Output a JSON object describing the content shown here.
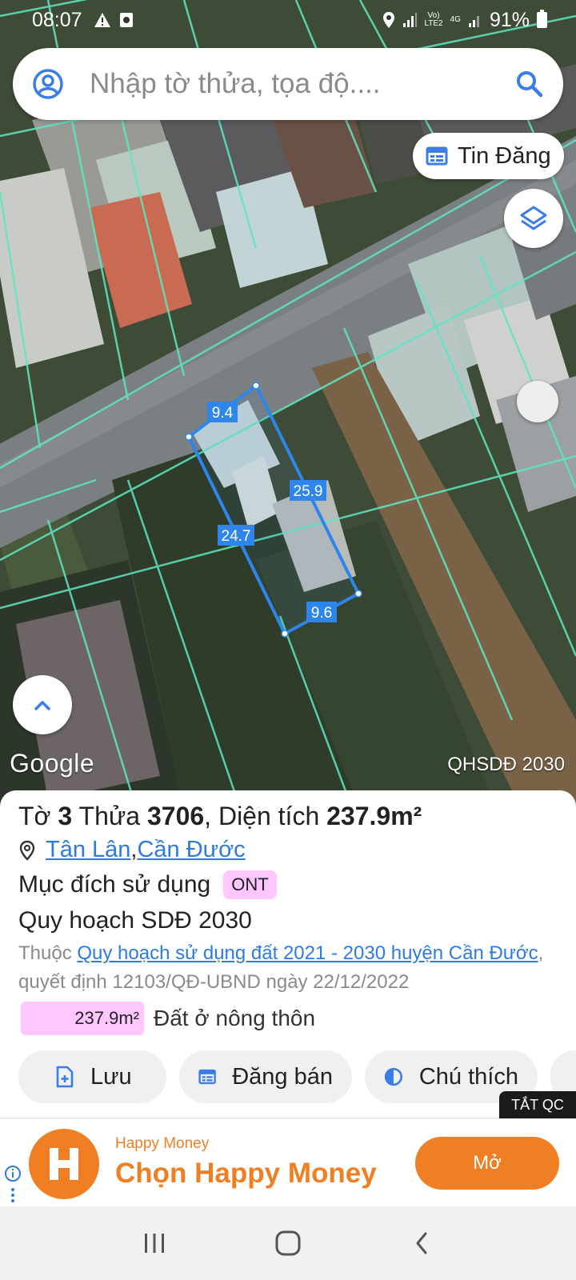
{
  "status_bar": {
    "time": "08:07",
    "network_line1": "Vo)",
    "network_line2": "LTE2",
    "network_type": "4G",
    "battery": "91%"
  },
  "search": {
    "placeholder": "Nhập tờ thửa, tọa độ...."
  },
  "map": {
    "news_chip_label": "Tin Đăng",
    "google_label": "Google",
    "plan_layer_label": "QHSDĐ 2030",
    "parcel_dimensions": {
      "top": "9.4",
      "right": "25.9",
      "left": "24.7",
      "bottom": "9.6"
    },
    "parcel_stroke_color": "#2f86ea",
    "boundary_color": "#5fe6c2"
  },
  "parcel": {
    "title_prefix": "Tờ ",
    "sheet_no": "3",
    "title_mid": " Thửa ",
    "plot_no": "3706",
    "title_area_label": ", Diện tích ",
    "area": "237.9m²",
    "commune": "Tân Lân",
    "location_separator": ", ",
    "district": "Cần Đước",
    "purpose_label": "Mục đích sử dụng",
    "purpose_code": "ONT",
    "plan_heading": "Quy hoạch SDĐ 2030",
    "plan_desc_prefix": "Thuộc ",
    "plan_link": "Quy hoạch sử dụng đất 2021 - 2030 huyện Cần Đước",
    "plan_desc_suffix": ", quyết định 12103/QĐ-UBND ngày 22/12/2022",
    "area_value": "237.9m²",
    "area_type": "Đất ở nông thôn",
    "tag_color": "#ffc6ff"
  },
  "actions": {
    "save": "Lưu",
    "post": "Đăng bán",
    "legend": "Chú thích"
  },
  "ad": {
    "close_label": "TẮT QC",
    "brand": "Happy Money",
    "headline": "Chọn Happy Money",
    "cta": "Mở",
    "logo_letter": "H",
    "accent": "#f07f24"
  },
  "colors": {
    "link": "#2d7be0",
    "icon_blue": "#3a7de6"
  }
}
